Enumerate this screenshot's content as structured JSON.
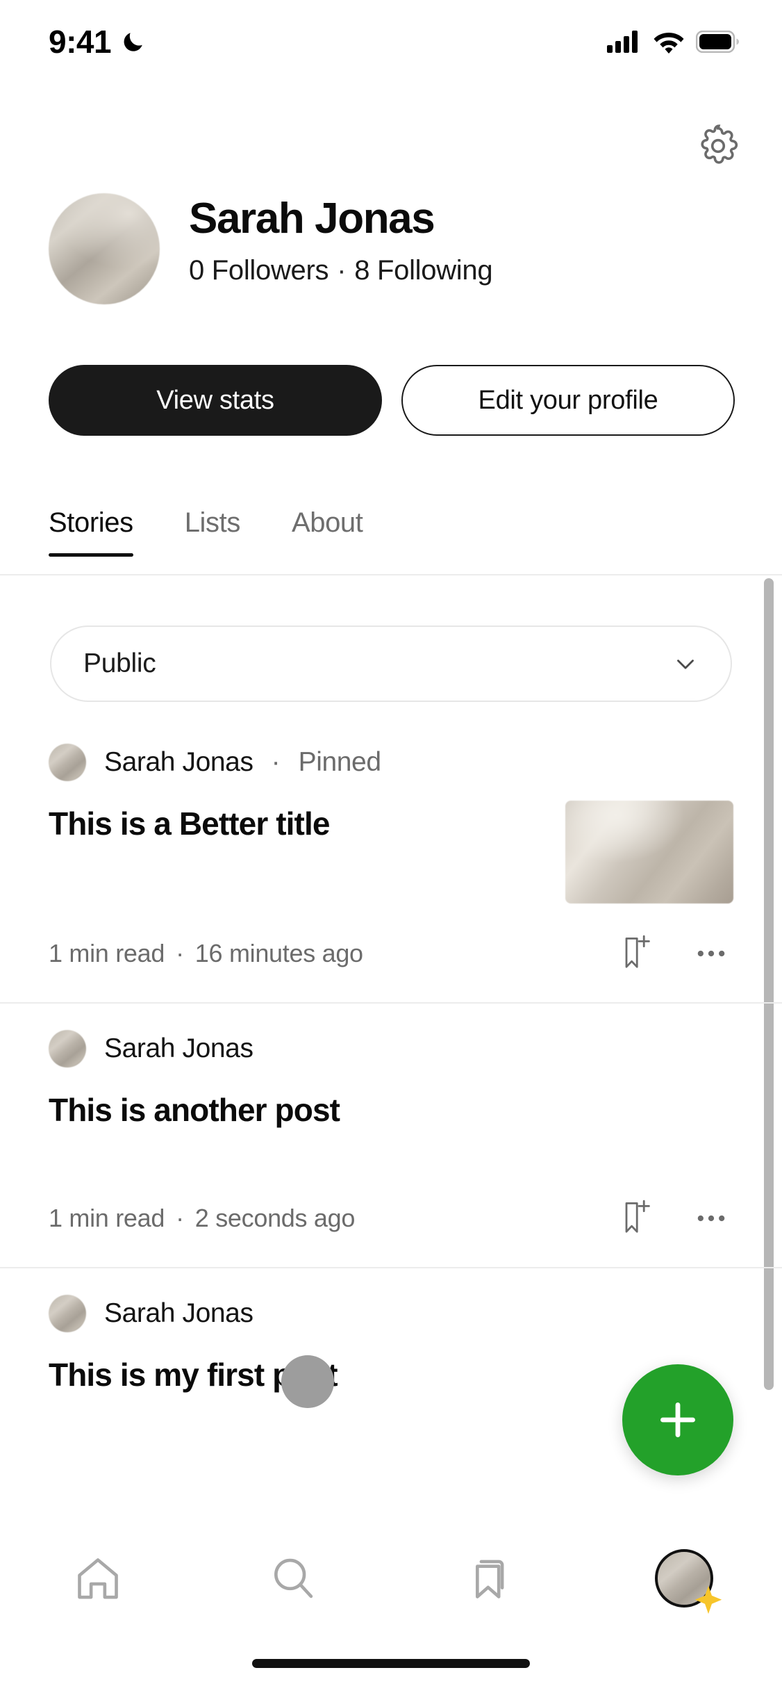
{
  "status_bar": {
    "time": "9:41",
    "dnd_icon": "crescent-moon-icon",
    "signal_icon": "cellular-signal-icon",
    "wifi_icon": "wifi-icon",
    "battery_icon": "battery-full-icon"
  },
  "header": {
    "settings_icon": "gear-icon"
  },
  "profile": {
    "name": "Sarah Jonas",
    "followers": "0 Followers",
    "separator": "·",
    "following": "8 Following",
    "avatar_icon": "profile-avatar-image"
  },
  "actions": {
    "primary_label": "View stats",
    "secondary_label": "Edit your profile"
  },
  "tabs": [
    {
      "label": "Stories",
      "active": true
    },
    {
      "label": "Lists",
      "active": false
    },
    {
      "label": "About",
      "active": false
    }
  ],
  "filter": {
    "value": "Public",
    "chevron_icon": "chevron-down-icon"
  },
  "stories": [
    {
      "author": "Sarah Jonas",
      "separator": "·",
      "tag": "Pinned",
      "title": "This is a Better title",
      "read_time": "1 min read",
      "meta_separator": "·",
      "timestamp": "16 minutes ago",
      "has_thumbnail": true,
      "bookmark_icon": "bookmark-add-icon",
      "more_icon": "more-horizontal-icon"
    },
    {
      "author": "Sarah Jonas",
      "separator": "",
      "tag": "",
      "title": "This is another post",
      "read_time": "1 min read",
      "meta_separator": "·",
      "timestamp": "2 seconds ago",
      "has_thumbnail": false,
      "bookmark_icon": "bookmark-add-icon",
      "more_icon": "more-horizontal-icon"
    },
    {
      "author": "Sarah Jonas",
      "separator": "",
      "tag": "",
      "title": "This is my first post",
      "read_time": "",
      "meta_separator": "",
      "timestamp": "",
      "has_thumbnail": false,
      "bookmark_icon": "",
      "more_icon": ""
    }
  ],
  "fab": {
    "icon": "plus-icon"
  },
  "bottom_nav": [
    {
      "icon": "home-icon",
      "active": false
    },
    {
      "icon": "search-icon",
      "active": false
    },
    {
      "icon": "bookmark-library-icon",
      "active": false
    },
    {
      "icon": "profile-avatar-icon",
      "active": true,
      "badge_icon": "sparkle-icon"
    }
  ],
  "colors": {
    "accent_green": "#23a12a",
    "primary_dark": "#1a1a1a",
    "muted_text": "#6b6b6b",
    "sparkle_yellow": "#f7c52b",
    "divider": "#ececec"
  }
}
